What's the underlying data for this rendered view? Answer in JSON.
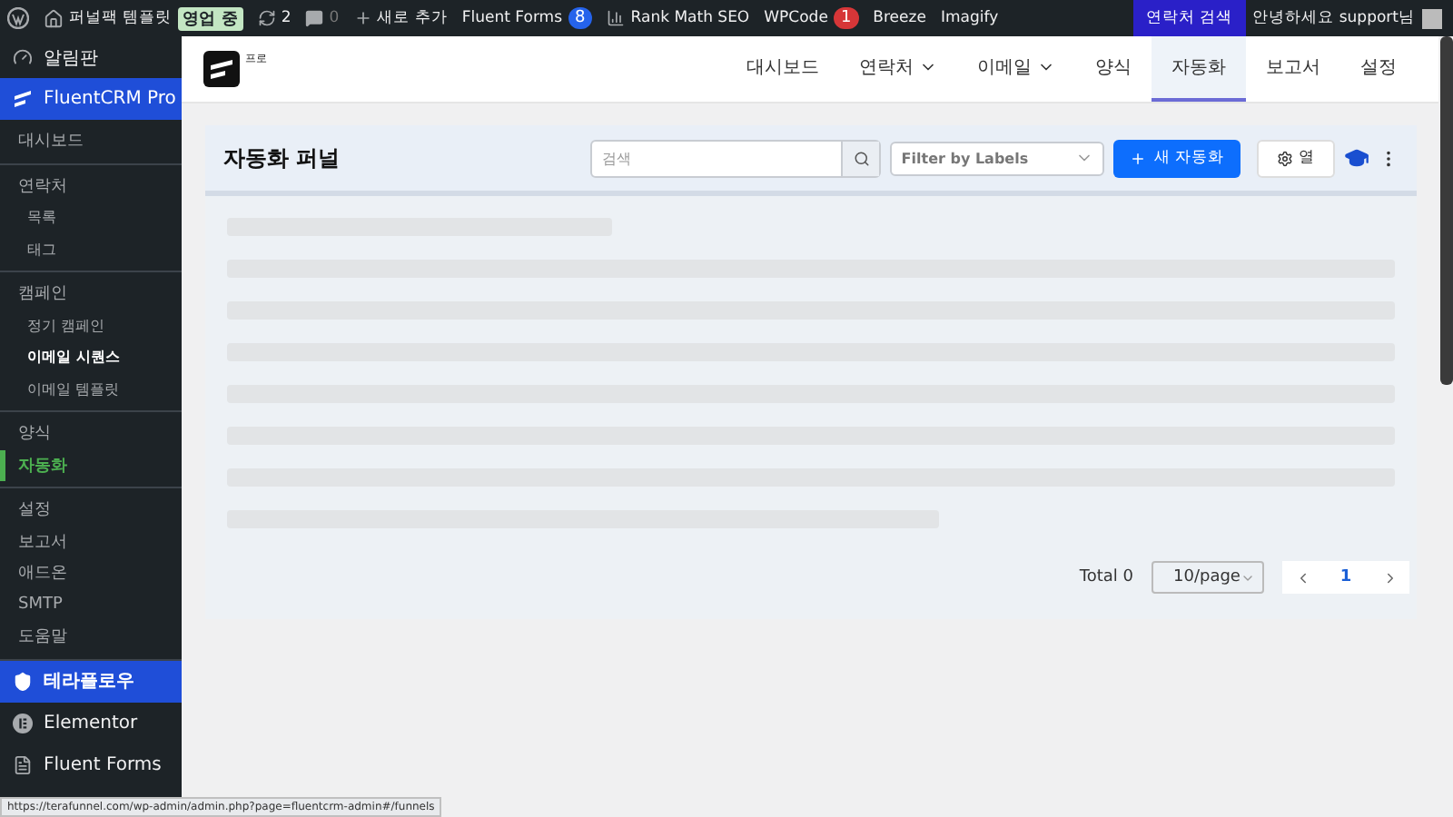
{
  "admin_bar": {
    "site_name": "퍼널팩 템플릿",
    "site_badge": "영업 중",
    "updates": "2",
    "comments": "0",
    "new_label": "새로 추가",
    "plugins": [
      {
        "label": "Fluent Forms",
        "count": "8",
        "kind": "count-blue"
      },
      {
        "label": "Rank Math SEO",
        "kind": "chart"
      },
      {
        "label": "WPCode",
        "count": "1",
        "kind": "count-red"
      },
      {
        "label": "Breeze",
        "kind": "plain"
      },
      {
        "label": "Imagify",
        "kind": "plain"
      }
    ],
    "contact_search": "연락처 검색",
    "greeting": "안녕하세요 support님"
  },
  "sidebar": {
    "top_item": "알림판",
    "plugin": "FluentCRM Pro",
    "groups": [
      [
        {
          "label": "대시보드",
          "kind": "top",
          "selected": false
        }
      ],
      [
        {
          "label": "연락처",
          "kind": "top",
          "selected": false
        },
        {
          "label": "목록",
          "kind": "sub",
          "selected": false
        },
        {
          "label": "태그",
          "kind": "sub",
          "selected": false
        }
      ],
      [
        {
          "label": "캠페인",
          "kind": "top",
          "selected": false
        },
        {
          "label": "정기 캠페인",
          "kind": "sub",
          "selected": false
        },
        {
          "label": "이메일 시퀀스",
          "kind": "sub",
          "selected": true
        },
        {
          "label": "이메일 템플릿",
          "kind": "sub",
          "selected": false
        }
      ],
      [
        {
          "label": "양식",
          "kind": "top",
          "selected": false
        },
        {
          "label": "자동화",
          "kind": "top",
          "selected": true
        }
      ],
      [
        {
          "label": "설정",
          "kind": "top",
          "selected": false
        },
        {
          "label": "보고서",
          "kind": "top",
          "selected": false
        },
        {
          "label": "애드온",
          "kind": "top",
          "selected": false
        },
        {
          "label": "SMTP",
          "kind": "top",
          "selected": false
        },
        {
          "label": "도움말",
          "kind": "top",
          "selected": false
        }
      ]
    ],
    "menu": [
      {
        "label": "테라플로우",
        "kind": "shield",
        "selected": true
      },
      {
        "label": "Elementor",
        "kind": "elementor",
        "selected": false
      },
      {
        "label": "Fluent Forms",
        "kind": "forms",
        "selected": false
      }
    ]
  },
  "header": {
    "logo_text": "프로",
    "nav": [
      {
        "label": "대시보드",
        "dropdown": false,
        "selected": false
      },
      {
        "label": "연락처",
        "dropdown": true,
        "selected": false
      },
      {
        "label": "이메일",
        "dropdown": true,
        "selected": false
      },
      {
        "label": "양식",
        "dropdown": false,
        "selected": false
      },
      {
        "label": "자동화",
        "dropdown": false,
        "selected": true
      },
      {
        "label": "보고서",
        "dropdown": false,
        "selected": false
      },
      {
        "label": "설정",
        "dropdown": false,
        "selected": false
      }
    ]
  },
  "panel": {
    "title": "자동화 퍼널",
    "search_placeholder": "검색",
    "label_filter_placeholder": "Filter by Labels",
    "new_button": "새 자동화",
    "columns_button": "열",
    "total": "Total 0",
    "page_size": "10/page",
    "pages": [
      {
        "label": "1",
        "selected": true
      }
    ]
  },
  "status_url": "https://terafunnel.com/wp-admin/admin.php?page=fluentcrm-admin#/funnels"
}
